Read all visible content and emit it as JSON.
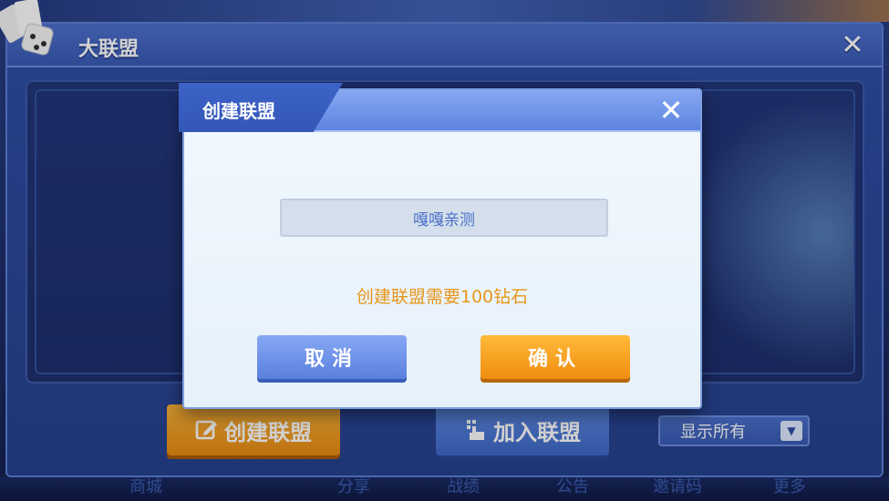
{
  "main": {
    "title": "大联盟",
    "close_symbol": "✕",
    "create_button": "创建联盟",
    "join_button": "加入联盟",
    "filter_value": "显示所有",
    "filter_arrow": "▼"
  },
  "bottom_nav": [
    "商城",
    "分享",
    "战绩",
    "公告",
    "邀请码",
    "更多"
  ],
  "dialog": {
    "title": "创建联盟",
    "close_symbol": "✕",
    "name_value": "嘎嘎亲测",
    "cost_text": "创建联盟需要100钻石",
    "cancel_label": "取消",
    "confirm_label": "确认"
  },
  "colors": {
    "accent_orange": "#f08e10",
    "accent_blue": "#5a80de",
    "cost_text": "#e8961a",
    "input_text": "#4a6ec7"
  },
  "icons": [
    "dice-logo-icon",
    "close-icon",
    "edit-icon",
    "hand-pointer-icon",
    "chevron-down-icon"
  ]
}
